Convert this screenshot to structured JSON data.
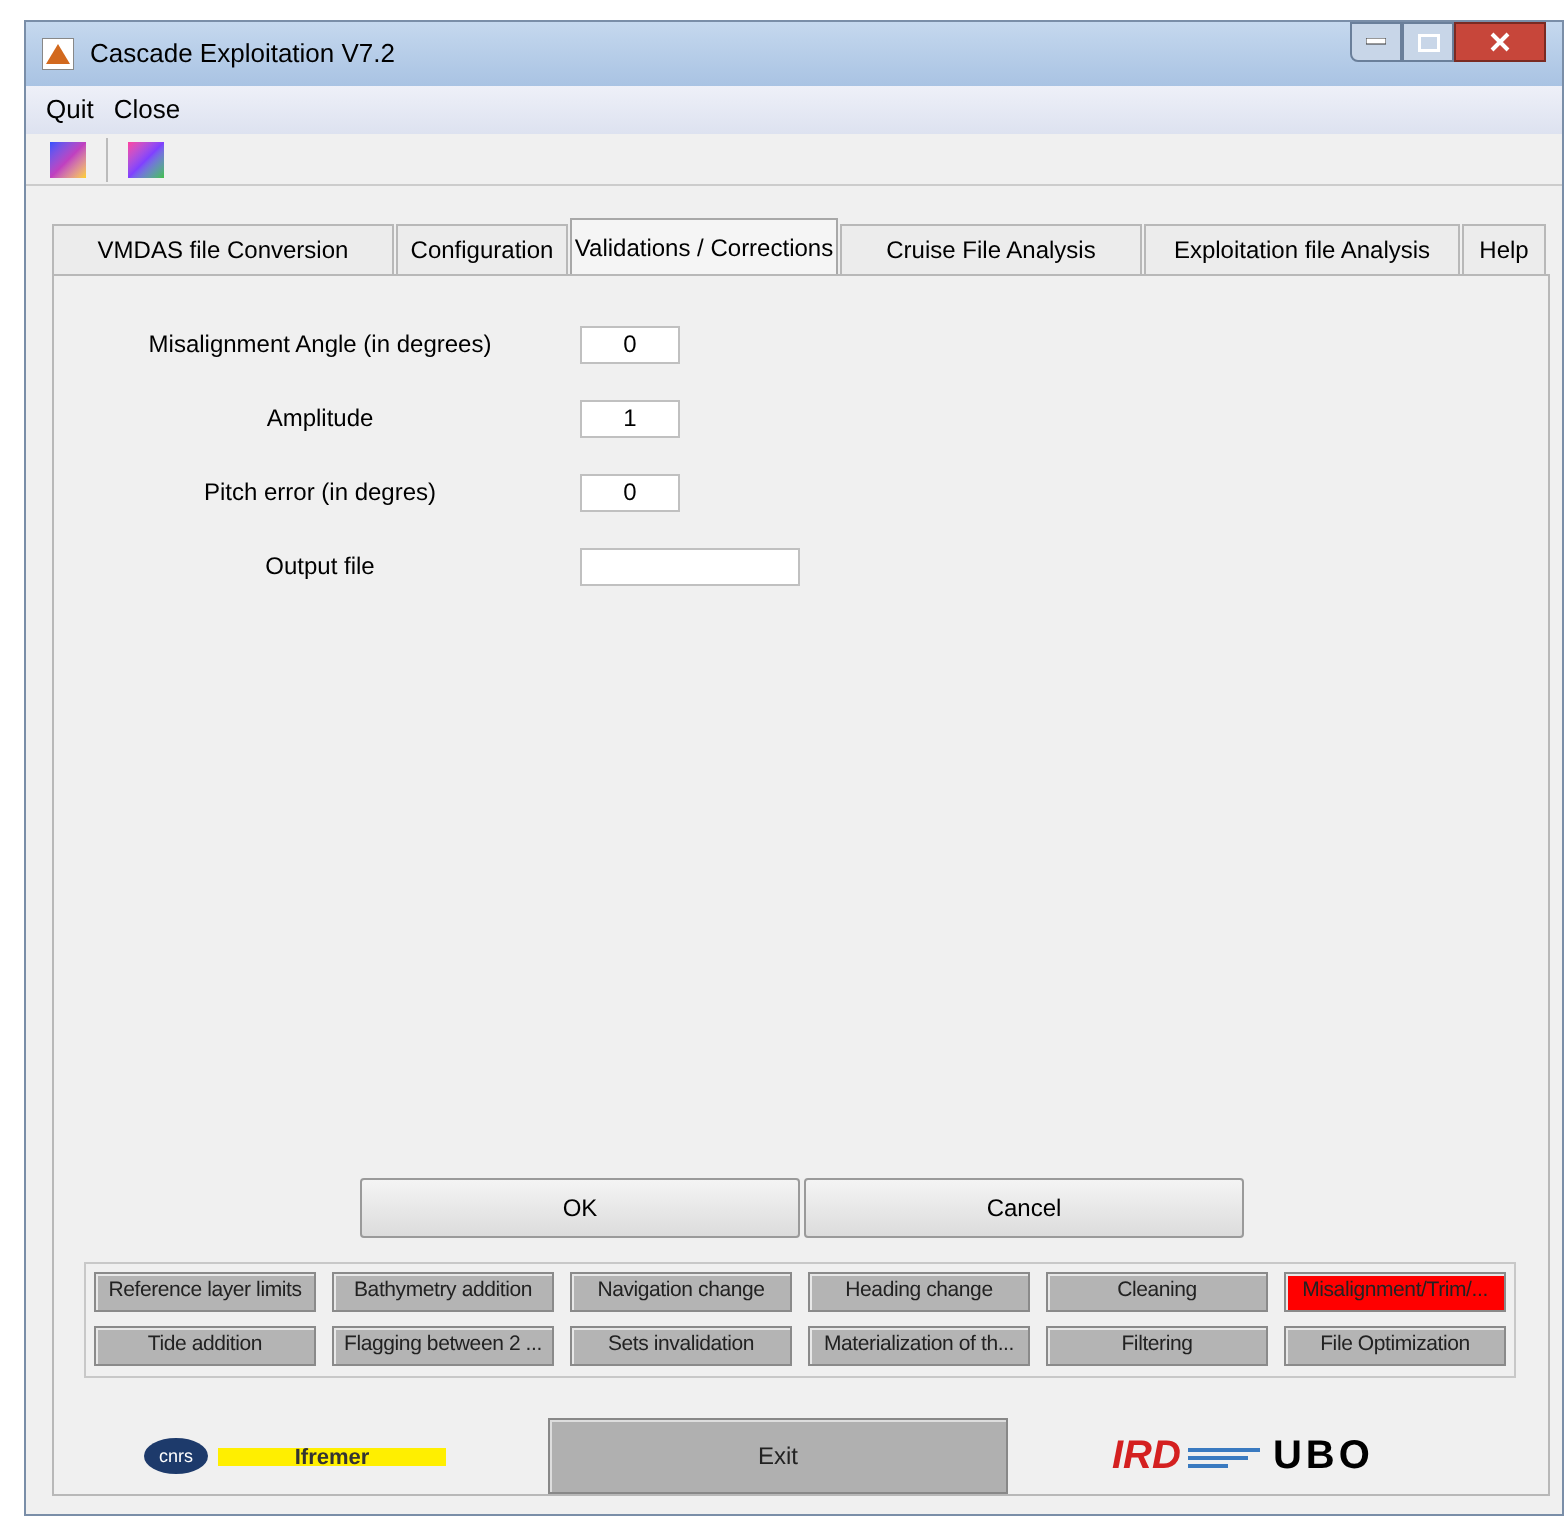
{
  "window": {
    "title": "Cascade Exploitation V7.2"
  },
  "menu": [
    "Quit",
    "Close"
  ],
  "tabs": [
    {
      "label": "VMDAS file Conversion",
      "selected": false
    },
    {
      "label": "Configuration",
      "selected": false
    },
    {
      "label": "Validations / Corrections",
      "selected": true
    },
    {
      "label": "Cruise File Analysis",
      "selected": false
    },
    {
      "label": "Exploitation file Analysis",
      "selected": false
    },
    {
      "label": "Help",
      "selected": false
    }
  ],
  "fields": [
    {
      "label": "Misalignment Angle (in degrees)",
      "value": "0"
    },
    {
      "label": "Amplitude",
      "value": "1"
    },
    {
      "label": "Pitch error (in degres)",
      "value": "0"
    },
    {
      "label": "Output file"
    }
  ],
  "dialog_buttons": [
    "OK",
    "Cancel"
  ],
  "tool_buttons": [
    {
      "label": "Reference layer limits",
      "selected": false
    },
    {
      "label": "Bathymetry addition",
      "selected": false
    },
    {
      "label": "Navigation change",
      "selected": false
    },
    {
      "label": "Heading change",
      "selected": false
    },
    {
      "label": "Cleaning",
      "selected": false
    },
    {
      "label": "Misalignment/Trim/...",
      "selected": true
    },
    {
      "label": "Tide addition",
      "selected": false
    },
    {
      "label": "Flagging between 2 ...",
      "selected": false
    },
    {
      "label": "Sets invalidation",
      "selected": false
    },
    {
      "label": "Materialization of th...",
      "selected": false
    },
    {
      "label": "Filtering",
      "selected": false
    },
    {
      "label": "File Optimization",
      "selected": false
    }
  ],
  "footer": {
    "logos_left": [
      "cnrs",
      "Ifremer"
    ],
    "exit": "Exit",
    "logos_right": [
      "IRD",
      "UBO"
    ]
  }
}
